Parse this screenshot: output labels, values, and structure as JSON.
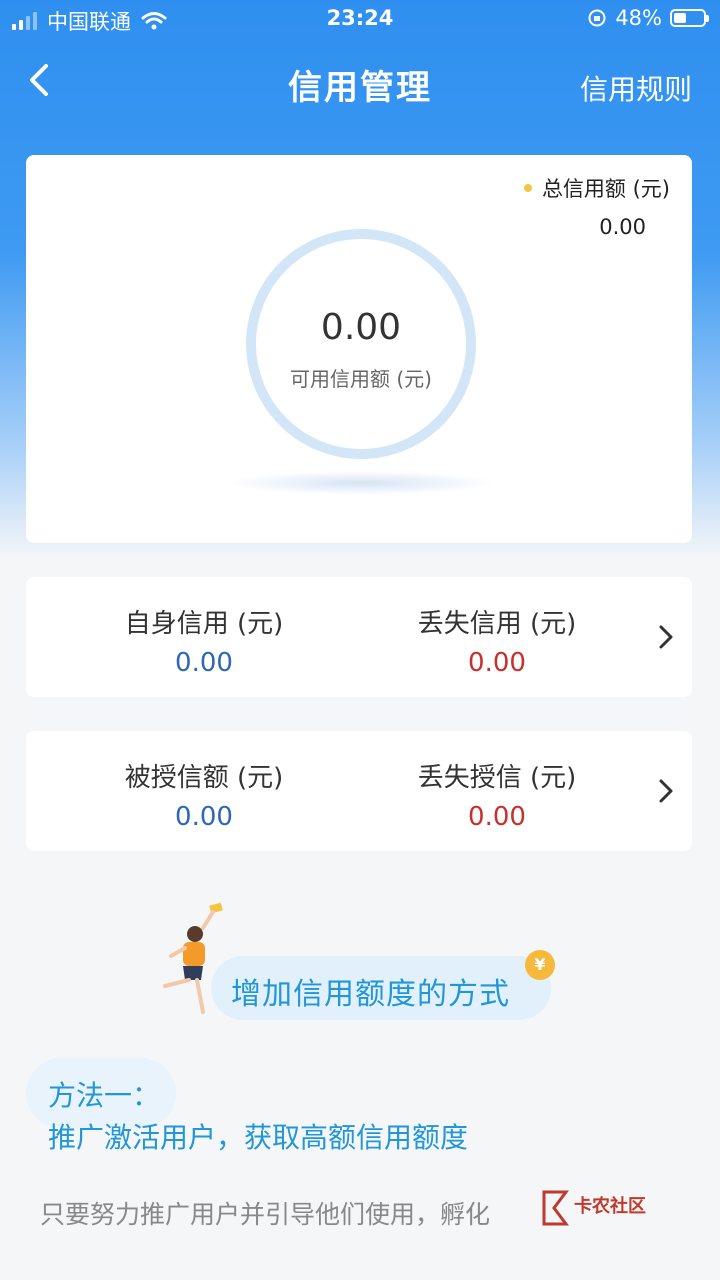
{
  "status_bar": {
    "carrier": "中国联通",
    "time": "23:24",
    "battery": "48%"
  },
  "nav": {
    "title": "信用管理",
    "rules_link": "信用规则"
  },
  "credit_summary": {
    "total_label": "总信用额 (元)",
    "total_value": "0.00",
    "available_value": "0.00",
    "available_label": "可用信用额 (元)"
  },
  "stats": [
    {
      "left_label": "自身信用 (元)",
      "left_value": "0.00",
      "right_label": "丢失信用 (元)",
      "right_value": "0.00"
    },
    {
      "left_label": "被授信额 (元)",
      "left_value": "0.00",
      "right_label": "丢失授信 (元)",
      "right_value": "0.00"
    }
  ],
  "promo": {
    "title": "增加信用额度的方式",
    "coin_symbol": "¥"
  },
  "method": {
    "title": "方法一：",
    "subtitle": "推广激活用户，获取高额信用额度",
    "description": "只要努力推广用户并引导他们使用，孵化"
  },
  "watermark": {
    "text": "卡农社区"
  },
  "colors": {
    "accent_blue": "#2196d8",
    "value_blue": "#2e67b8",
    "value_red": "#c9302c",
    "header_blue": "#2f8ff0"
  }
}
